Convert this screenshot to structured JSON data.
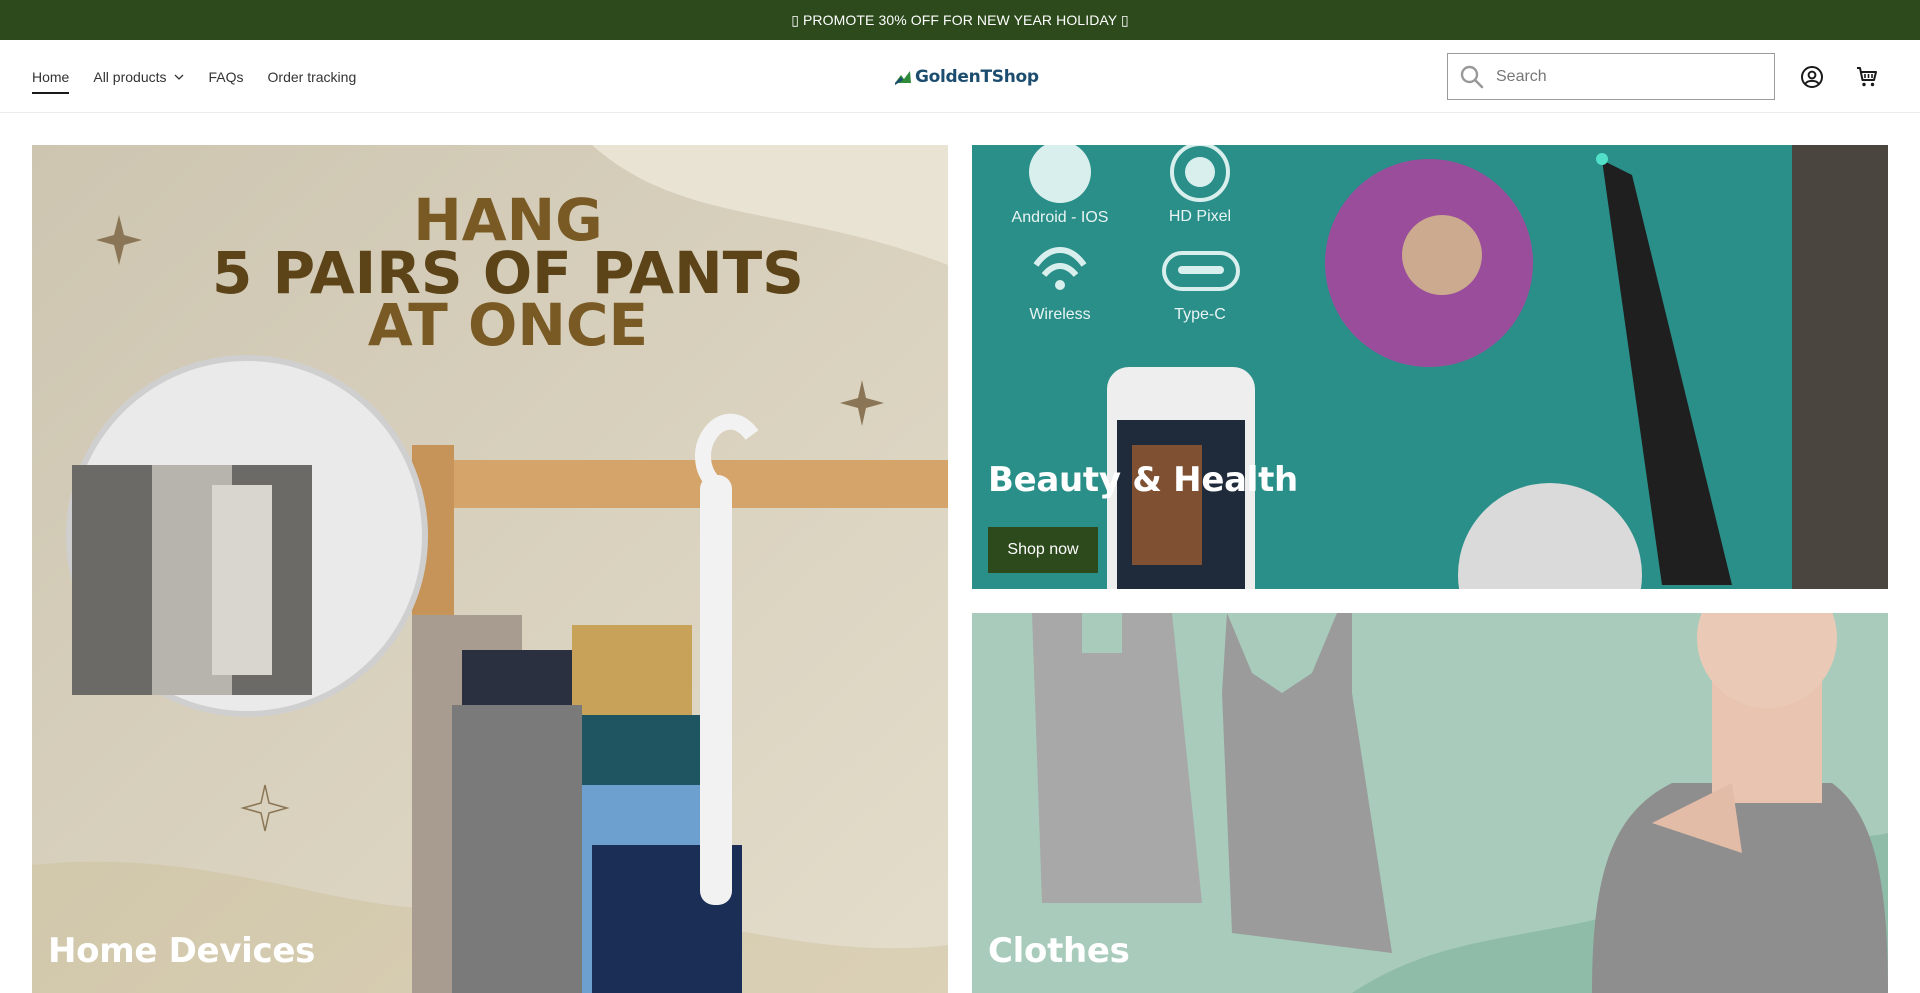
{
  "announcement": {
    "text": "▯ PROMOTE 30% OFF FOR NEW YEAR HOLIDAY ▯"
  },
  "nav": {
    "items": [
      {
        "label": "Home",
        "active": true
      },
      {
        "label": "All products",
        "has_dropdown": true
      },
      {
        "label": "FAQs"
      },
      {
        "label": "Order tracking"
      }
    ]
  },
  "logo": {
    "text": "GoldenTShop"
  },
  "search": {
    "placeholder": "Search",
    "value": ""
  },
  "icons": {
    "search": "search-icon",
    "account": "account-icon",
    "cart": "cart-icon",
    "chevron": "chevron-down-icon"
  },
  "collections": {
    "home": {
      "title": "Home Devices",
      "headline": [
        "HANG",
        "5 PAIRS OF PANTS",
        "AT ONCE"
      ]
    },
    "beauty": {
      "title": "Beauty & Health",
      "button": "Shop now",
      "features": [
        "Android - IOS",
        "HD Pixel",
        "Wireless",
        "Type-C"
      ]
    },
    "clothes": {
      "title": "Clothes"
    }
  },
  "colors": {
    "brand_green": "#2d4a1c",
    "logo_blue": "#1c4d6e"
  }
}
